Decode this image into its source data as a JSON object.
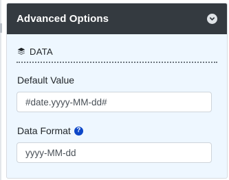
{
  "panel": {
    "title": "Advanced Options",
    "collapse_icon": "chevron-circle-down-icon",
    "section": {
      "icon": "layers-icon",
      "title": "DATA"
    },
    "fields": [
      {
        "label": "Default Value",
        "value": "#date.yyyy-MM-dd#",
        "has_help": false
      },
      {
        "label": "Data Format",
        "value": "yyyy-MM-dd",
        "has_help": true,
        "help_icon": "question-circle-icon",
        "help_glyph": "?"
      }
    ]
  },
  "colors": {
    "header_bg": "#343a40",
    "panel_bg": "#eef7ff",
    "help_icon": "#0d47c8"
  }
}
